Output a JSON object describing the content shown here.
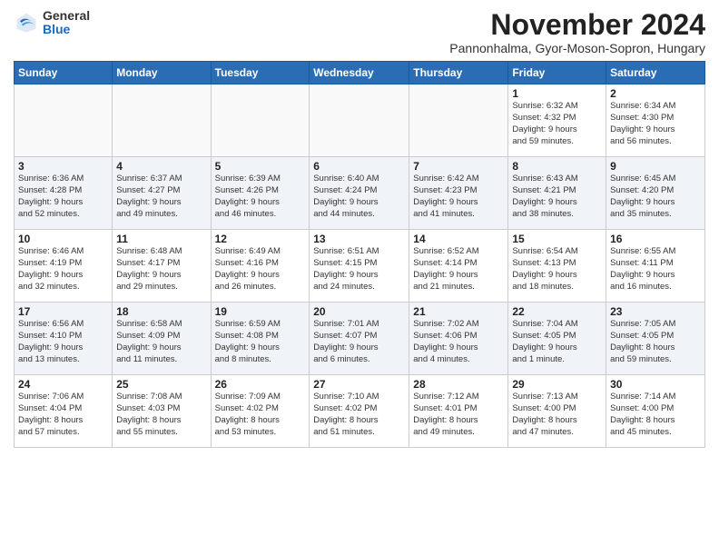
{
  "logo": {
    "general": "General",
    "blue": "Blue"
  },
  "title": "November 2024",
  "subtitle": "Pannonhalma, Gyor-Moson-Sopron, Hungary",
  "headers": [
    "Sunday",
    "Monday",
    "Tuesday",
    "Wednesday",
    "Thursday",
    "Friday",
    "Saturday"
  ],
  "weeks": [
    {
      "shaded": false,
      "days": [
        {
          "num": "",
          "info": ""
        },
        {
          "num": "",
          "info": ""
        },
        {
          "num": "",
          "info": ""
        },
        {
          "num": "",
          "info": ""
        },
        {
          "num": "",
          "info": ""
        },
        {
          "num": "1",
          "info": "Sunrise: 6:32 AM\nSunset: 4:32 PM\nDaylight: 9 hours\nand 59 minutes."
        },
        {
          "num": "2",
          "info": "Sunrise: 6:34 AM\nSunset: 4:30 PM\nDaylight: 9 hours\nand 56 minutes."
        }
      ]
    },
    {
      "shaded": true,
      "days": [
        {
          "num": "3",
          "info": "Sunrise: 6:36 AM\nSunset: 4:28 PM\nDaylight: 9 hours\nand 52 minutes."
        },
        {
          "num": "4",
          "info": "Sunrise: 6:37 AM\nSunset: 4:27 PM\nDaylight: 9 hours\nand 49 minutes."
        },
        {
          "num": "5",
          "info": "Sunrise: 6:39 AM\nSunset: 4:26 PM\nDaylight: 9 hours\nand 46 minutes."
        },
        {
          "num": "6",
          "info": "Sunrise: 6:40 AM\nSunset: 4:24 PM\nDaylight: 9 hours\nand 44 minutes."
        },
        {
          "num": "7",
          "info": "Sunrise: 6:42 AM\nSunset: 4:23 PM\nDaylight: 9 hours\nand 41 minutes."
        },
        {
          "num": "8",
          "info": "Sunrise: 6:43 AM\nSunset: 4:21 PM\nDaylight: 9 hours\nand 38 minutes."
        },
        {
          "num": "9",
          "info": "Sunrise: 6:45 AM\nSunset: 4:20 PM\nDaylight: 9 hours\nand 35 minutes."
        }
      ]
    },
    {
      "shaded": false,
      "days": [
        {
          "num": "10",
          "info": "Sunrise: 6:46 AM\nSunset: 4:19 PM\nDaylight: 9 hours\nand 32 minutes."
        },
        {
          "num": "11",
          "info": "Sunrise: 6:48 AM\nSunset: 4:17 PM\nDaylight: 9 hours\nand 29 minutes."
        },
        {
          "num": "12",
          "info": "Sunrise: 6:49 AM\nSunset: 4:16 PM\nDaylight: 9 hours\nand 26 minutes."
        },
        {
          "num": "13",
          "info": "Sunrise: 6:51 AM\nSunset: 4:15 PM\nDaylight: 9 hours\nand 24 minutes."
        },
        {
          "num": "14",
          "info": "Sunrise: 6:52 AM\nSunset: 4:14 PM\nDaylight: 9 hours\nand 21 minutes."
        },
        {
          "num": "15",
          "info": "Sunrise: 6:54 AM\nSunset: 4:13 PM\nDaylight: 9 hours\nand 18 minutes."
        },
        {
          "num": "16",
          "info": "Sunrise: 6:55 AM\nSunset: 4:11 PM\nDaylight: 9 hours\nand 16 minutes."
        }
      ]
    },
    {
      "shaded": true,
      "days": [
        {
          "num": "17",
          "info": "Sunrise: 6:56 AM\nSunset: 4:10 PM\nDaylight: 9 hours\nand 13 minutes."
        },
        {
          "num": "18",
          "info": "Sunrise: 6:58 AM\nSunset: 4:09 PM\nDaylight: 9 hours\nand 11 minutes."
        },
        {
          "num": "19",
          "info": "Sunrise: 6:59 AM\nSunset: 4:08 PM\nDaylight: 9 hours\nand 8 minutes."
        },
        {
          "num": "20",
          "info": "Sunrise: 7:01 AM\nSunset: 4:07 PM\nDaylight: 9 hours\nand 6 minutes."
        },
        {
          "num": "21",
          "info": "Sunrise: 7:02 AM\nSunset: 4:06 PM\nDaylight: 9 hours\nand 4 minutes."
        },
        {
          "num": "22",
          "info": "Sunrise: 7:04 AM\nSunset: 4:05 PM\nDaylight: 9 hours\nand 1 minute."
        },
        {
          "num": "23",
          "info": "Sunrise: 7:05 AM\nSunset: 4:05 PM\nDaylight: 8 hours\nand 59 minutes."
        }
      ]
    },
    {
      "shaded": false,
      "days": [
        {
          "num": "24",
          "info": "Sunrise: 7:06 AM\nSunset: 4:04 PM\nDaylight: 8 hours\nand 57 minutes."
        },
        {
          "num": "25",
          "info": "Sunrise: 7:08 AM\nSunset: 4:03 PM\nDaylight: 8 hours\nand 55 minutes."
        },
        {
          "num": "26",
          "info": "Sunrise: 7:09 AM\nSunset: 4:02 PM\nDaylight: 8 hours\nand 53 minutes."
        },
        {
          "num": "27",
          "info": "Sunrise: 7:10 AM\nSunset: 4:02 PM\nDaylight: 8 hours\nand 51 minutes."
        },
        {
          "num": "28",
          "info": "Sunrise: 7:12 AM\nSunset: 4:01 PM\nDaylight: 8 hours\nand 49 minutes."
        },
        {
          "num": "29",
          "info": "Sunrise: 7:13 AM\nSunset: 4:00 PM\nDaylight: 8 hours\nand 47 minutes."
        },
        {
          "num": "30",
          "info": "Sunrise: 7:14 AM\nSunset: 4:00 PM\nDaylight: 8 hours\nand 45 minutes."
        }
      ]
    }
  ]
}
